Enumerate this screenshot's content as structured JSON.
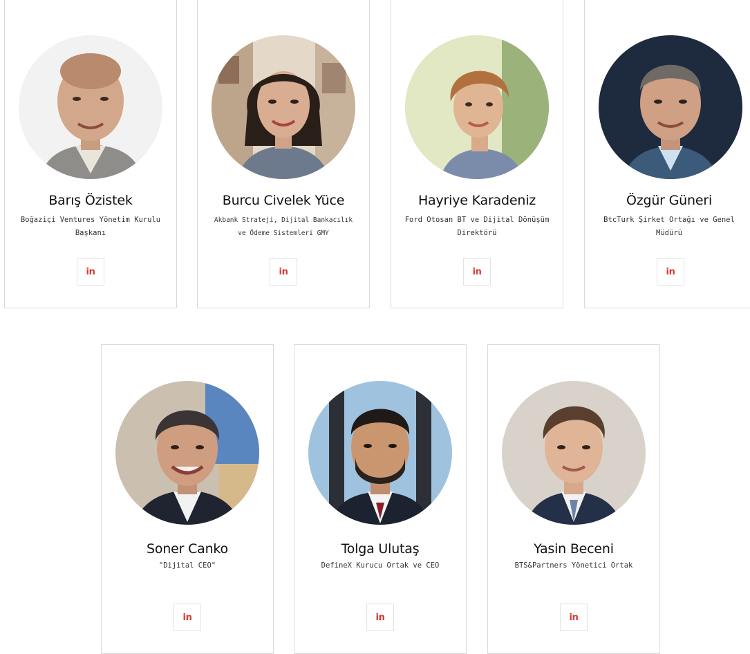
{
  "linkedin_label": "in",
  "accent_color": "#d83a2e",
  "people": [
    {
      "name": "Barış Özistek",
      "title": "Boğaziçi Ventures Yönetim Kurulu Başkanı"
    },
    {
      "name": "Burcu Civelek Yüce",
      "title": "Akbank Strateji, Dijital Bankacılık ve Ödeme Sistemleri GMY"
    },
    {
      "name": "Hayriye Karadeniz",
      "title": "Ford Otosan BT ve Dijital Dönüşüm Direktörü"
    },
    {
      "name": "Özgür Güneri",
      "title": "BtcTurk Şirket Ortağı ve Genel Müdürü"
    },
    {
      "name": "Soner Canko",
      "title": "\"Dijital CEO\""
    },
    {
      "name": "Tolga Ulutaş",
      "title": "DefineX Kurucu Ortak ve CEO"
    },
    {
      "name": "Yasin Beceni",
      "title": "BTS&Partners Yönetici Ortak"
    }
  ]
}
